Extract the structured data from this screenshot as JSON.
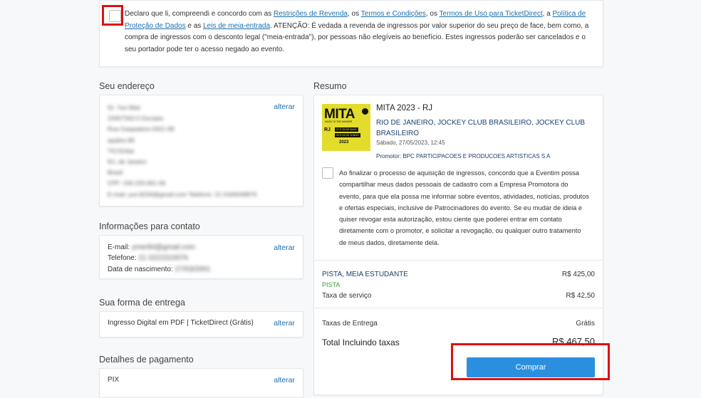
{
  "declaration": {
    "parts": [
      {
        "t": "Declaro que li, compreendi e concordo com as ",
        "link": false
      },
      {
        "t": "Restrições de Revenda",
        "link": true
      },
      {
        "t": ", os ",
        "link": false
      },
      {
        "t": "Termos e Condições",
        "link": true
      },
      {
        "t": ", os ",
        "link": false
      },
      {
        "t": "Termos de Uso para TicketDirect",
        "link": true
      },
      {
        "t": ", a ",
        "link": false
      },
      {
        "t": "Política de Proteção de Dados",
        "link": true
      },
      {
        "t": " e as ",
        "link": false
      },
      {
        "t": "Leis de meia-entrada",
        "link": true
      },
      {
        "t": ". ATENÇÃO: É vedada a revenda de ingressos por valor superior do seu preço de face, bem como, a compra de ingressos com o desconto legal (\"meia-entrada\"), por pessoas não elegíveis ao benefício. Estes ingressos poderão ser cancelados e o seu portador pode ter o acesso negado ao evento.",
        "link": false
      }
    ]
  },
  "address": {
    "title": "Seu endereço",
    "edit_label": "alterar",
    "lines": [
      "Dr. Yuri Mair",
      "23457342-5 Escopia",
      "Rua Gaspadora 0321-99",
      "apalira 99",
      "TICOUlas",
      "RJ, de Janeiro",
      "Brasil",
      "CPF: 100.220.061-56",
      "E-mail: yuri.8234@gmail.com Telefone: 21 0184049876"
    ]
  },
  "contact": {
    "title": "Informações para contato",
    "edit_label": "alterar",
    "email_label": "E-mail:",
    "email_value": "ymer84@gmail.com",
    "phone_label": "Telefone:",
    "phone_value": "21 0222310076",
    "birth_label": "Data de nascimento:",
    "birth_value": "27/03/2001"
  },
  "delivery": {
    "title": "Sua forma de entrega",
    "edit_label": "alterar",
    "method": "Ingresso Digital em PDF | TicketDirect (Grátis)"
  },
  "payment": {
    "title": "Detalhes de pagamento",
    "edit_label": "alterar",
    "method": "PIX"
  },
  "summary": {
    "title": "Resumo",
    "event_name": "MITA 2023 - RJ",
    "venue": "RIO DE JANEIRO, JOCKEY CLUB BRASILEIRO, JOCKEY CLUB BRASILEIRO",
    "date": "Sábado, 27/05/2023, 12:45",
    "promoter": "Promotor: BPC PARTICIPACOES E PRODUCOES ARTISTICAS S A",
    "poster": {
      "brand": "MITA",
      "tagline": "MUSIC IS THE ANSWER",
      "city": "RJ",
      "dates1": "27 E 28 DE MAIO",
      "dates2": "03 E 04 DE JUNHO",
      "year": "2023",
      "bg": "#e3dc2a"
    },
    "consent": "Ao finalizar o processo de aquisição de ingressos, concordo que a Eventim possa compartilhar meus dados pessoais de cadastro com a Empresa Promotora do evento, para que ela possa me informar sobre eventos, atividades, notícias, produtos e ofertas especiais, inclusive de Patrocinadores do evento. Se eu mudar de ideia e quiser revogar esta autorização, estou ciente que poderei entrar em contato diretamente com o promotor, e solicitar a revogação, ou qualquer outro tratamento de meus dados, diretamente dela.",
    "ticket_type": "PISTA, MEIA ESTUDANTE",
    "ticket_price": "R$ 425,00",
    "ticket_area": "PISTA",
    "service_label": "Taxa de serviço",
    "service_value": "R$ 42,50",
    "delivery_fee_label": "Taxas de Entrega",
    "delivery_fee_value": "Grátis",
    "total_label": "Total Incluindo taxas",
    "total_value": "R$ 467,50",
    "buy_label": "Comprar"
  },
  "colors": {
    "link": "#1a6fb0",
    "button": "#2b8fe0",
    "green": "#3a9a3a",
    "highlight": "#d11"
  }
}
